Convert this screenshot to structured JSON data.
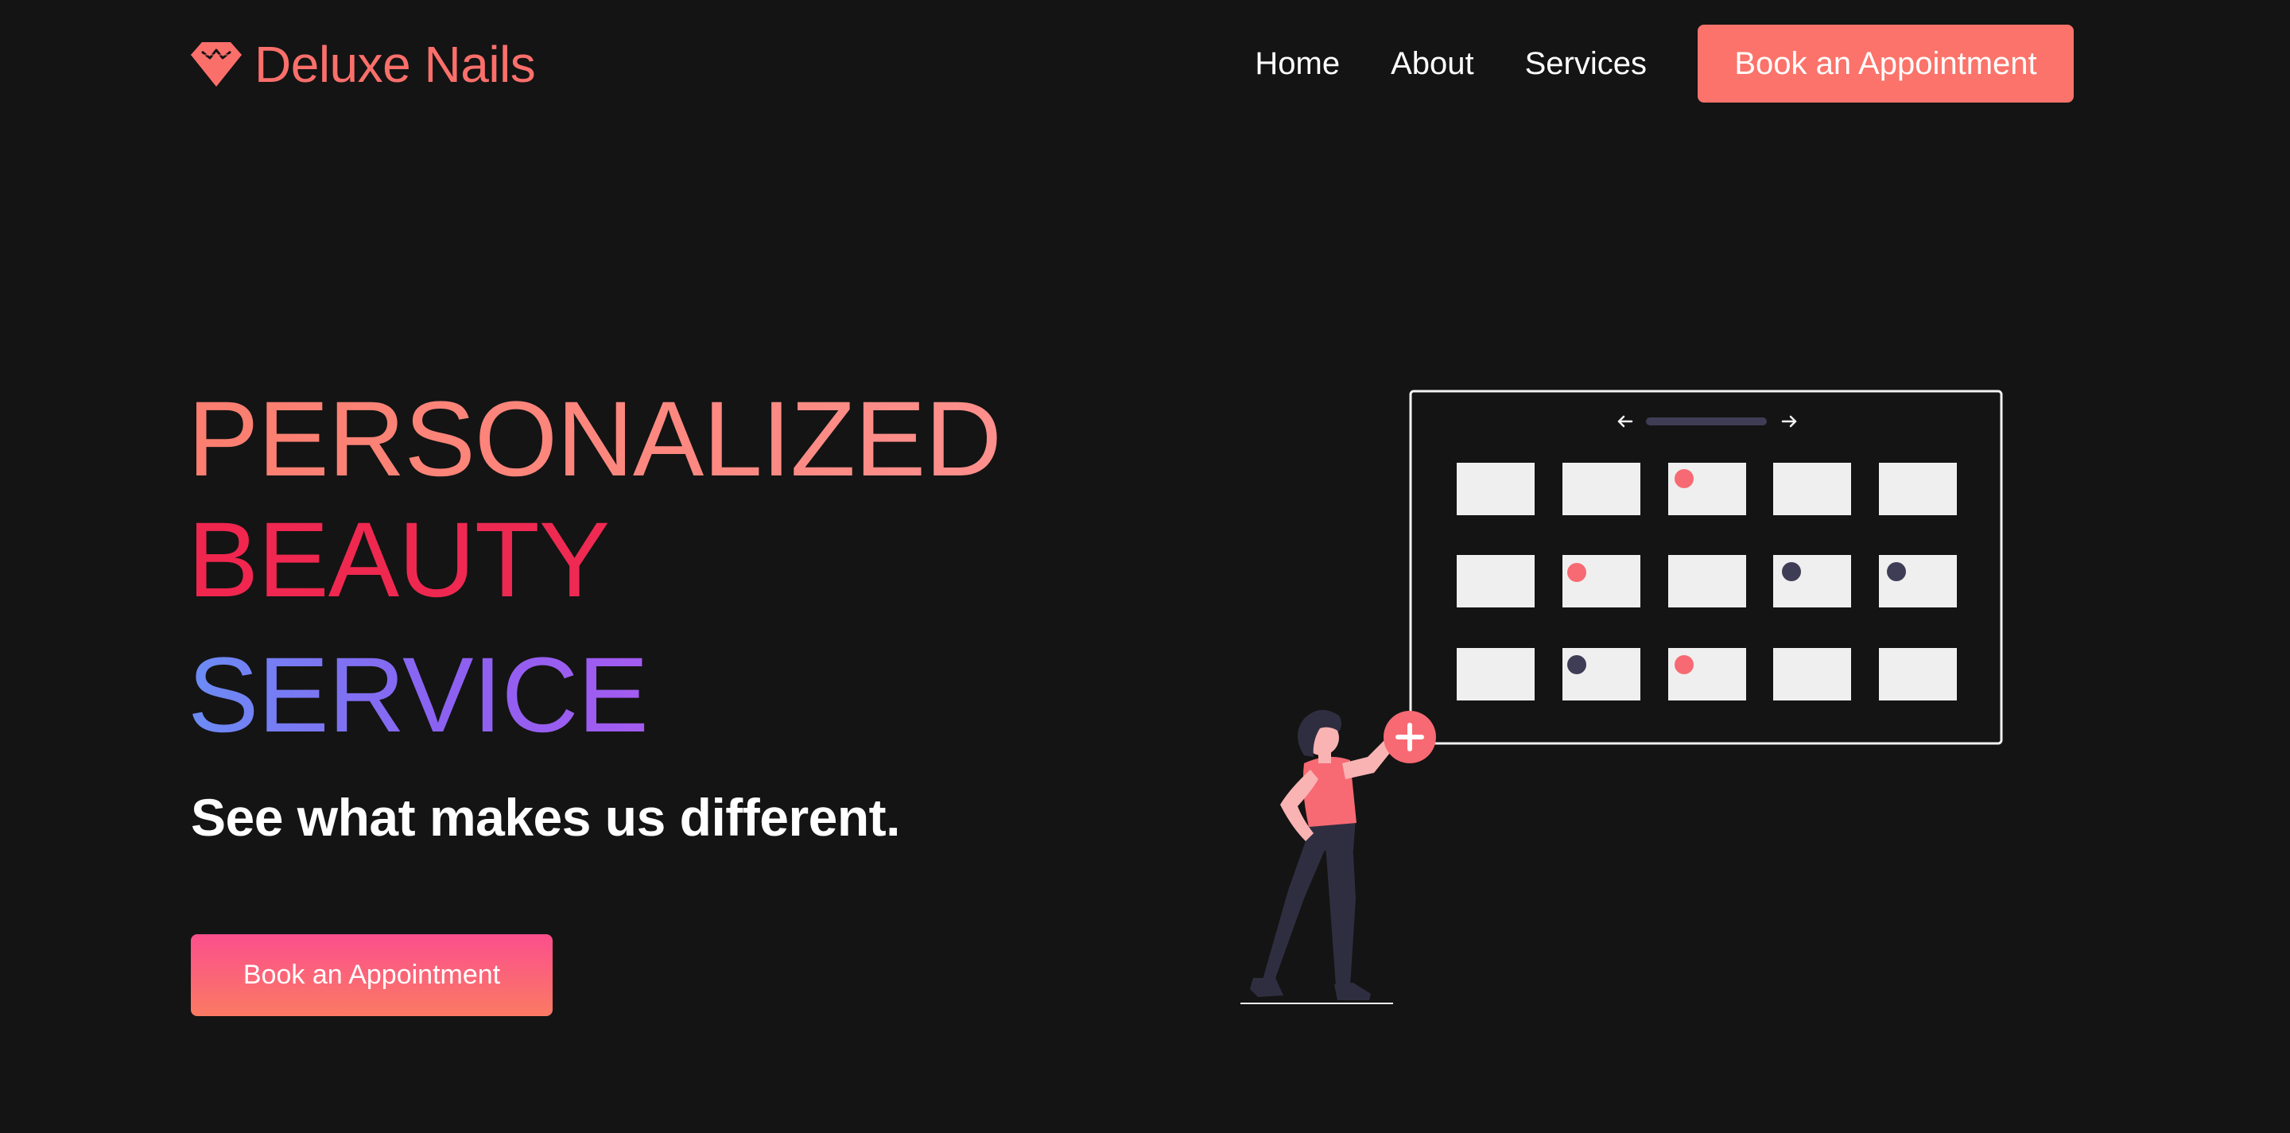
{
  "brand": {
    "name": "Deluxe Nails",
    "icon": "diamond-icon",
    "color": "#fb6f6b"
  },
  "nav": {
    "links": [
      "Home",
      "About",
      "Services"
    ],
    "cta_label": "Book an Appointment",
    "cta_color": "#fb736a"
  },
  "hero": {
    "line1": "PERSONALIZED",
    "line2": "BEAUTY",
    "line3": "SERVICE",
    "subtitle": "See what makes us different.",
    "cta_label": "Book an Appointment"
  },
  "illustration": {
    "name": "calendar-booking-illustration",
    "accent_color": "#f76a73",
    "dark_color": "#3f3d56"
  },
  "colors": {
    "background": "#141414"
  }
}
